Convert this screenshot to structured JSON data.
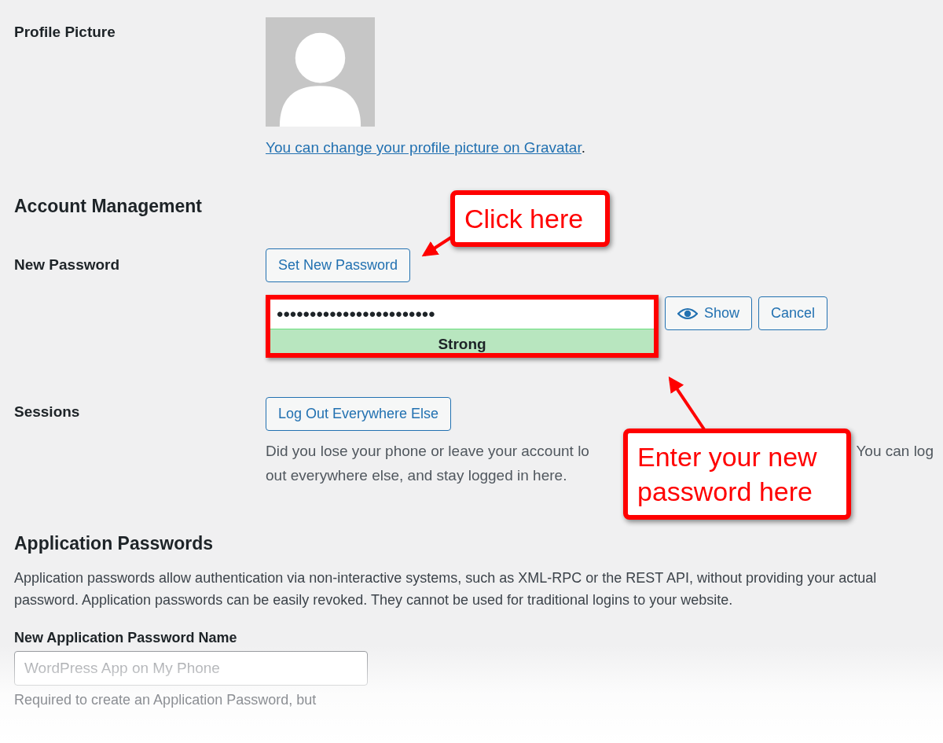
{
  "profile_picture": {
    "label": "Profile Picture",
    "link": "You can change your profile picture on Gravatar",
    "link_suffix": "."
  },
  "account_management": {
    "heading": "Account Management",
    "new_password": {
      "label": "New Password",
      "button": "Set New Password",
      "value": "••••••••••••••••••••••••",
      "highlighted": true,
      "strength": {
        "label": "Strong",
        "kind": "strong"
      },
      "show_button": "Show",
      "cancel_button": "Cancel"
    },
    "sessions": {
      "label": "Sessions",
      "button": "Log Out Everywhere Else",
      "description_parts": [
        "Did you lose your phone or leave your account lo",
        "You can log",
        "out everywhere else, and stay logged in here."
      ]
    }
  },
  "application_passwords": {
    "heading": "Application Passwords",
    "description": "Application passwords allow authentication via non-interactive systems, such as XML-RPC or the REST API, without providing your actual password. Application passwords can be easily revoked. They cannot be used for traditional logins to your website.",
    "name_label": "New Application Password Name",
    "name_placeholder": "WordPress App on My Phone",
    "help": "Required to create an Application Password, but"
  },
  "annotations": [
    {
      "kind": "callout",
      "text": "Click here"
    },
    {
      "kind": "callout",
      "text": "Enter your new password here"
    }
  ]
}
